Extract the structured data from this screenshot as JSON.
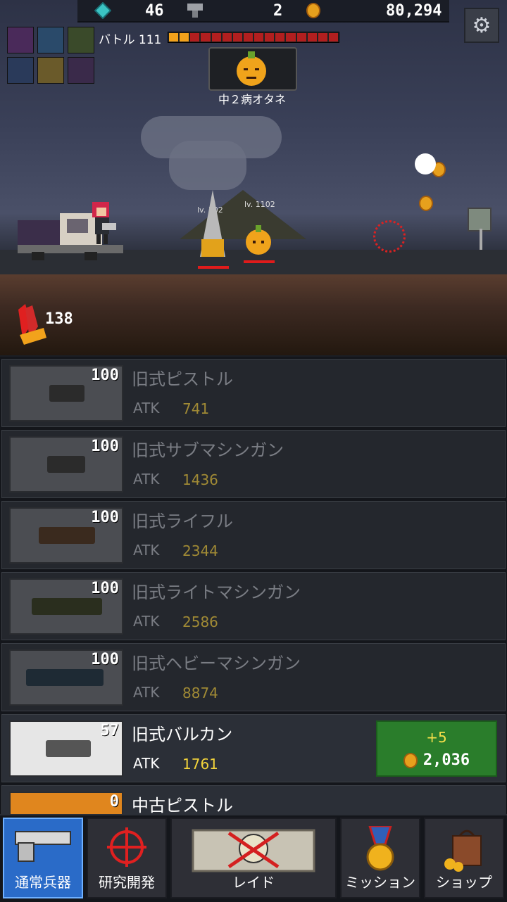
{
  "topbar": {
    "gems": "46",
    "bolts": "2",
    "gold": "80,294"
  },
  "battle": {
    "label": "バトル 111",
    "progress_fraction": 0.125,
    "boss_name": "中２病オタネ",
    "enemy_levels": [
      "lv. 102",
      "lv. 1102"
    ],
    "ammo": "138"
  },
  "weapons": [
    {
      "name": "旧式ピストル",
      "level": "100",
      "atk_label": "ATK",
      "atk": "741"
    },
    {
      "name": "旧式サブマシンガン",
      "level": "100",
      "atk_label": "ATK",
      "atk": "1436"
    },
    {
      "name": "旧式ライフル",
      "level": "100",
      "atk_label": "ATK",
      "atk": "2344"
    },
    {
      "name": "旧式ライトマシンガン",
      "level": "100",
      "atk_label": "ATK",
      "atk": "2586"
    },
    {
      "name": "旧式ヘビーマシンガン",
      "level": "100",
      "atk_label": "ATK",
      "atk": "8874"
    },
    {
      "name": "旧式バルカン",
      "level": "57",
      "atk_label": "ATK",
      "atk": "1761",
      "upgrade_plus": "+5",
      "upgrade_cost": "2,036"
    },
    {
      "name": "中古ピストル",
      "level": "0"
    }
  ],
  "nav": {
    "tabs": [
      {
        "label": "通常兵器",
        "icon": "pistol-icon"
      },
      {
        "label": "研究開発",
        "icon": "crosshair-icon"
      },
      {
        "label": "レイド",
        "icon": "skull-map-icon"
      },
      {
        "label": "ミッション",
        "icon": "medal-icon"
      },
      {
        "label": "ショップ",
        "icon": "shopping-bag-icon"
      }
    ]
  },
  "colors": {
    "accent_blue": "#2a6bc8",
    "upgrade_green": "#2a7d2b",
    "atk_gold": "#f3d43b",
    "hp_red": "#b21f1f",
    "progress_orange": "#f2a21b"
  }
}
